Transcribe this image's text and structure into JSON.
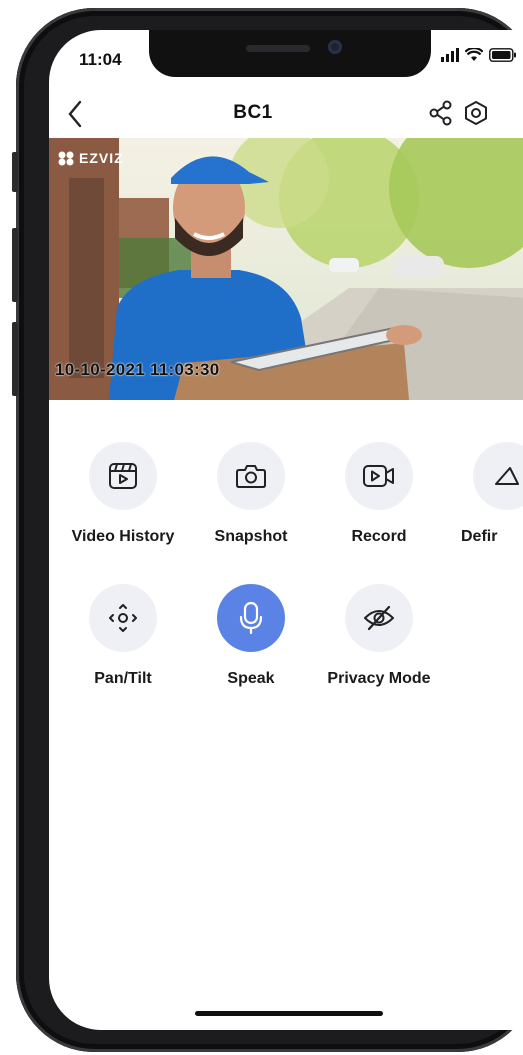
{
  "status_bar": {
    "time": "11:04"
  },
  "header": {
    "title": "BC1",
    "back_icon": "chevron-left-icon",
    "share_icon": "share-icon",
    "settings_icon": "hex-settings-icon"
  },
  "video": {
    "brand": "EZVIZ",
    "timestamp": "10-10-2021 11:03:30"
  },
  "controls": [
    {
      "label": "Video History",
      "icon": "video-history-icon"
    },
    {
      "label": "Snapshot",
      "icon": "camera-icon"
    },
    {
      "label": "Record",
      "icon": "video-record-icon"
    },
    {
      "label": "Defir",
      "icon": "definition-icon"
    },
    {
      "label": "Pan/Tilt",
      "icon": "pan-tilt-icon"
    },
    {
      "label": "Speak",
      "icon": "microphone-icon",
      "active": true
    },
    {
      "label": "Privacy Mode",
      "icon": "eye-off-icon"
    }
  ],
  "colors": {
    "accent": "#5b83e6",
    "button_bg": "#eef0f5"
  }
}
